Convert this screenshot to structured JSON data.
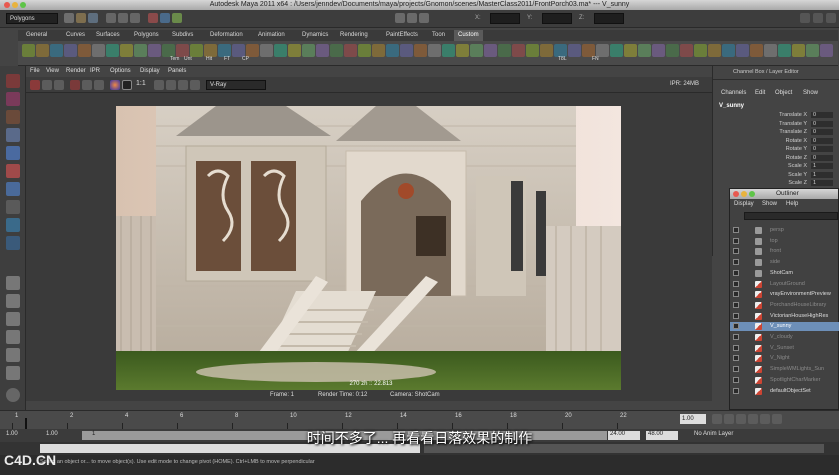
{
  "window": {
    "title": "Autodesk Maya 2011 x64 : /Users/jenndev/Documents/maya/projects/Gnomon/scenes/MasterClass2011/FrontPorch03.ma*  ---  V_sunny"
  },
  "status_line": {
    "menu_set": "Polygons",
    "field_x": "X:",
    "field_y": "Y:",
    "field_z": "Z:"
  },
  "shelf_tabs": [
    "General",
    "Curves",
    "Surfaces",
    "Polygons",
    "Subdivs",
    "Deformation",
    "Animation",
    "Dynamics",
    "Rendering",
    "PaintEffects",
    "Toon",
    "Custom"
  ],
  "shelf_active_tab": "Custom",
  "shelf_labels": [
    "Tem",
    "Unt",
    "Hit",
    "FT",
    "CP",
    "T8L",
    "FN"
  ],
  "panel_menu": [
    "File",
    "View",
    "Render",
    "IPR",
    "Options",
    "Display",
    "Panels"
  ],
  "panel_toolbar": {
    "ratio": "1:1",
    "camera_select": "V-Ray",
    "memory": "IPR: 24MB"
  },
  "render_info": {
    "frame": "Frame:  1",
    "render_time": "Render Time: 0:12",
    "camera": "Camera:  ShotCam",
    "overlay": "270 zh ::  22.813"
  },
  "channel_box": {
    "header": "Channel Box / Layer Editor",
    "menu": [
      "Channels",
      "Edit",
      "Object",
      "Show"
    ],
    "object": "V_sunny",
    "attributes": [
      {
        "name": "Translate X",
        "value": "0"
      },
      {
        "name": "Translate Y",
        "value": "0"
      },
      {
        "name": "Translate Z",
        "value": "0"
      },
      {
        "name": "Rotate X",
        "value": "0"
      },
      {
        "name": "Rotate Y",
        "value": "0"
      },
      {
        "name": "Rotate Z",
        "value": "0"
      },
      {
        "name": "Scale X",
        "value": "1"
      },
      {
        "name": "Scale Y",
        "value": "1"
      },
      {
        "name": "Scale Z",
        "value": "1"
      }
    ]
  },
  "outliner": {
    "title": "Outliner",
    "menu": [
      "Display",
      "Show",
      "Help"
    ],
    "items": [
      {
        "label": "persp",
        "dim": true,
        "icon": "camera"
      },
      {
        "label": "top",
        "dim": true,
        "icon": "camera"
      },
      {
        "label": "front",
        "dim": true,
        "icon": "camera"
      },
      {
        "label": "side",
        "dim": true,
        "icon": "camera"
      },
      {
        "label": "ShotCam",
        "dim": false,
        "icon": "camera"
      },
      {
        "label": "LayoutGround",
        "dim": true,
        "icon": "set"
      },
      {
        "label": "vrayEnvironmentPreview",
        "dim": false,
        "icon": "set"
      },
      {
        "label": "PorchandHouseLibrary",
        "dim": true,
        "icon": "set"
      },
      {
        "label": "VictorianHouseHighRes",
        "dim": false,
        "icon": "set"
      },
      {
        "label": "V_sunny",
        "dim": false,
        "icon": "set",
        "selected": true
      },
      {
        "label": "V_cloudy",
        "dim": true,
        "icon": "set"
      },
      {
        "label": "V_Sunset",
        "dim": true,
        "icon": "set"
      },
      {
        "label": "V_Night",
        "dim": true,
        "icon": "set"
      },
      {
        "label": "SimpleWMLights_Sun",
        "dim": true,
        "icon": "set"
      },
      {
        "label": "SpotlightCharMarker",
        "dim": true,
        "icon": "set"
      },
      {
        "label": "defaultObjectSet",
        "dim": false,
        "icon": "set"
      }
    ]
  },
  "time": {
    "ticks": [
      "1",
      "2",
      "4",
      "6",
      "8",
      "10",
      "12",
      "14",
      "16",
      "18",
      "20",
      "22"
    ],
    "current": "1.00",
    "range_start": "1.00",
    "range_inner_start": "1.00",
    "range_marker": "1",
    "range_end_a": "24.00",
    "range_end_b": "48.00",
    "anim_layer": "No Anim Layer"
  },
  "help_line": "Select an object or... to move object(s). Use edit mode to change pivot (HOME).  Ctrl+LMB to move perpendicular",
  "subtitle": "时间不多了... 再看看日落效果的制作",
  "watermark": "C4D.CN"
}
